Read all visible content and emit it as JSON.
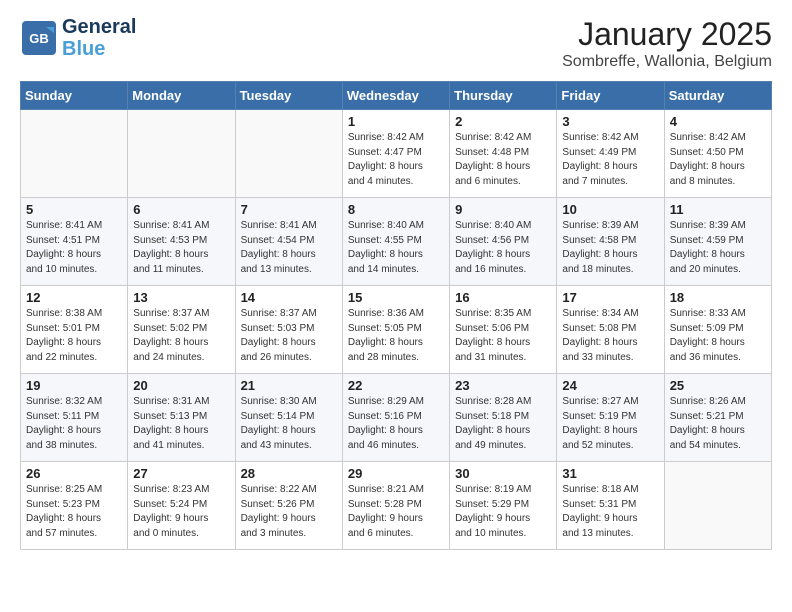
{
  "header": {
    "logo_general": "General",
    "logo_blue": "Blue",
    "title": "January 2025",
    "subtitle": "Sombreffe, Wallonia, Belgium"
  },
  "days_of_week": [
    "Sunday",
    "Monday",
    "Tuesday",
    "Wednesday",
    "Thursday",
    "Friday",
    "Saturday"
  ],
  "weeks": [
    [
      {
        "day": "",
        "info": ""
      },
      {
        "day": "",
        "info": ""
      },
      {
        "day": "",
        "info": ""
      },
      {
        "day": "1",
        "info": "Sunrise: 8:42 AM\nSunset: 4:47 PM\nDaylight: 8 hours\nand 4 minutes."
      },
      {
        "day": "2",
        "info": "Sunrise: 8:42 AM\nSunset: 4:48 PM\nDaylight: 8 hours\nand 6 minutes."
      },
      {
        "day": "3",
        "info": "Sunrise: 8:42 AM\nSunset: 4:49 PM\nDaylight: 8 hours\nand 7 minutes."
      },
      {
        "day": "4",
        "info": "Sunrise: 8:42 AM\nSunset: 4:50 PM\nDaylight: 8 hours\nand 8 minutes."
      }
    ],
    [
      {
        "day": "5",
        "info": "Sunrise: 8:41 AM\nSunset: 4:51 PM\nDaylight: 8 hours\nand 10 minutes."
      },
      {
        "day": "6",
        "info": "Sunrise: 8:41 AM\nSunset: 4:53 PM\nDaylight: 8 hours\nand 11 minutes."
      },
      {
        "day": "7",
        "info": "Sunrise: 8:41 AM\nSunset: 4:54 PM\nDaylight: 8 hours\nand 13 minutes."
      },
      {
        "day": "8",
        "info": "Sunrise: 8:40 AM\nSunset: 4:55 PM\nDaylight: 8 hours\nand 14 minutes."
      },
      {
        "day": "9",
        "info": "Sunrise: 8:40 AM\nSunset: 4:56 PM\nDaylight: 8 hours\nand 16 minutes."
      },
      {
        "day": "10",
        "info": "Sunrise: 8:39 AM\nSunset: 4:58 PM\nDaylight: 8 hours\nand 18 minutes."
      },
      {
        "day": "11",
        "info": "Sunrise: 8:39 AM\nSunset: 4:59 PM\nDaylight: 8 hours\nand 20 minutes."
      }
    ],
    [
      {
        "day": "12",
        "info": "Sunrise: 8:38 AM\nSunset: 5:01 PM\nDaylight: 8 hours\nand 22 minutes."
      },
      {
        "day": "13",
        "info": "Sunrise: 8:37 AM\nSunset: 5:02 PM\nDaylight: 8 hours\nand 24 minutes."
      },
      {
        "day": "14",
        "info": "Sunrise: 8:37 AM\nSunset: 5:03 PM\nDaylight: 8 hours\nand 26 minutes."
      },
      {
        "day": "15",
        "info": "Sunrise: 8:36 AM\nSunset: 5:05 PM\nDaylight: 8 hours\nand 28 minutes."
      },
      {
        "day": "16",
        "info": "Sunrise: 8:35 AM\nSunset: 5:06 PM\nDaylight: 8 hours\nand 31 minutes."
      },
      {
        "day": "17",
        "info": "Sunrise: 8:34 AM\nSunset: 5:08 PM\nDaylight: 8 hours\nand 33 minutes."
      },
      {
        "day": "18",
        "info": "Sunrise: 8:33 AM\nSunset: 5:09 PM\nDaylight: 8 hours\nand 36 minutes."
      }
    ],
    [
      {
        "day": "19",
        "info": "Sunrise: 8:32 AM\nSunset: 5:11 PM\nDaylight: 8 hours\nand 38 minutes."
      },
      {
        "day": "20",
        "info": "Sunrise: 8:31 AM\nSunset: 5:13 PM\nDaylight: 8 hours\nand 41 minutes."
      },
      {
        "day": "21",
        "info": "Sunrise: 8:30 AM\nSunset: 5:14 PM\nDaylight: 8 hours\nand 43 minutes."
      },
      {
        "day": "22",
        "info": "Sunrise: 8:29 AM\nSunset: 5:16 PM\nDaylight: 8 hours\nand 46 minutes."
      },
      {
        "day": "23",
        "info": "Sunrise: 8:28 AM\nSunset: 5:18 PM\nDaylight: 8 hours\nand 49 minutes."
      },
      {
        "day": "24",
        "info": "Sunrise: 8:27 AM\nSunset: 5:19 PM\nDaylight: 8 hours\nand 52 minutes."
      },
      {
        "day": "25",
        "info": "Sunrise: 8:26 AM\nSunset: 5:21 PM\nDaylight: 8 hours\nand 54 minutes."
      }
    ],
    [
      {
        "day": "26",
        "info": "Sunrise: 8:25 AM\nSunset: 5:23 PM\nDaylight: 8 hours\nand 57 minutes."
      },
      {
        "day": "27",
        "info": "Sunrise: 8:23 AM\nSunset: 5:24 PM\nDaylight: 9 hours\nand 0 minutes."
      },
      {
        "day": "28",
        "info": "Sunrise: 8:22 AM\nSunset: 5:26 PM\nDaylight: 9 hours\nand 3 minutes."
      },
      {
        "day": "29",
        "info": "Sunrise: 8:21 AM\nSunset: 5:28 PM\nDaylight: 9 hours\nand 6 minutes."
      },
      {
        "day": "30",
        "info": "Sunrise: 8:19 AM\nSunset: 5:29 PM\nDaylight: 9 hours\nand 10 minutes."
      },
      {
        "day": "31",
        "info": "Sunrise: 8:18 AM\nSunset: 5:31 PM\nDaylight: 9 hours\nand 13 minutes."
      },
      {
        "day": "",
        "info": ""
      }
    ]
  ]
}
